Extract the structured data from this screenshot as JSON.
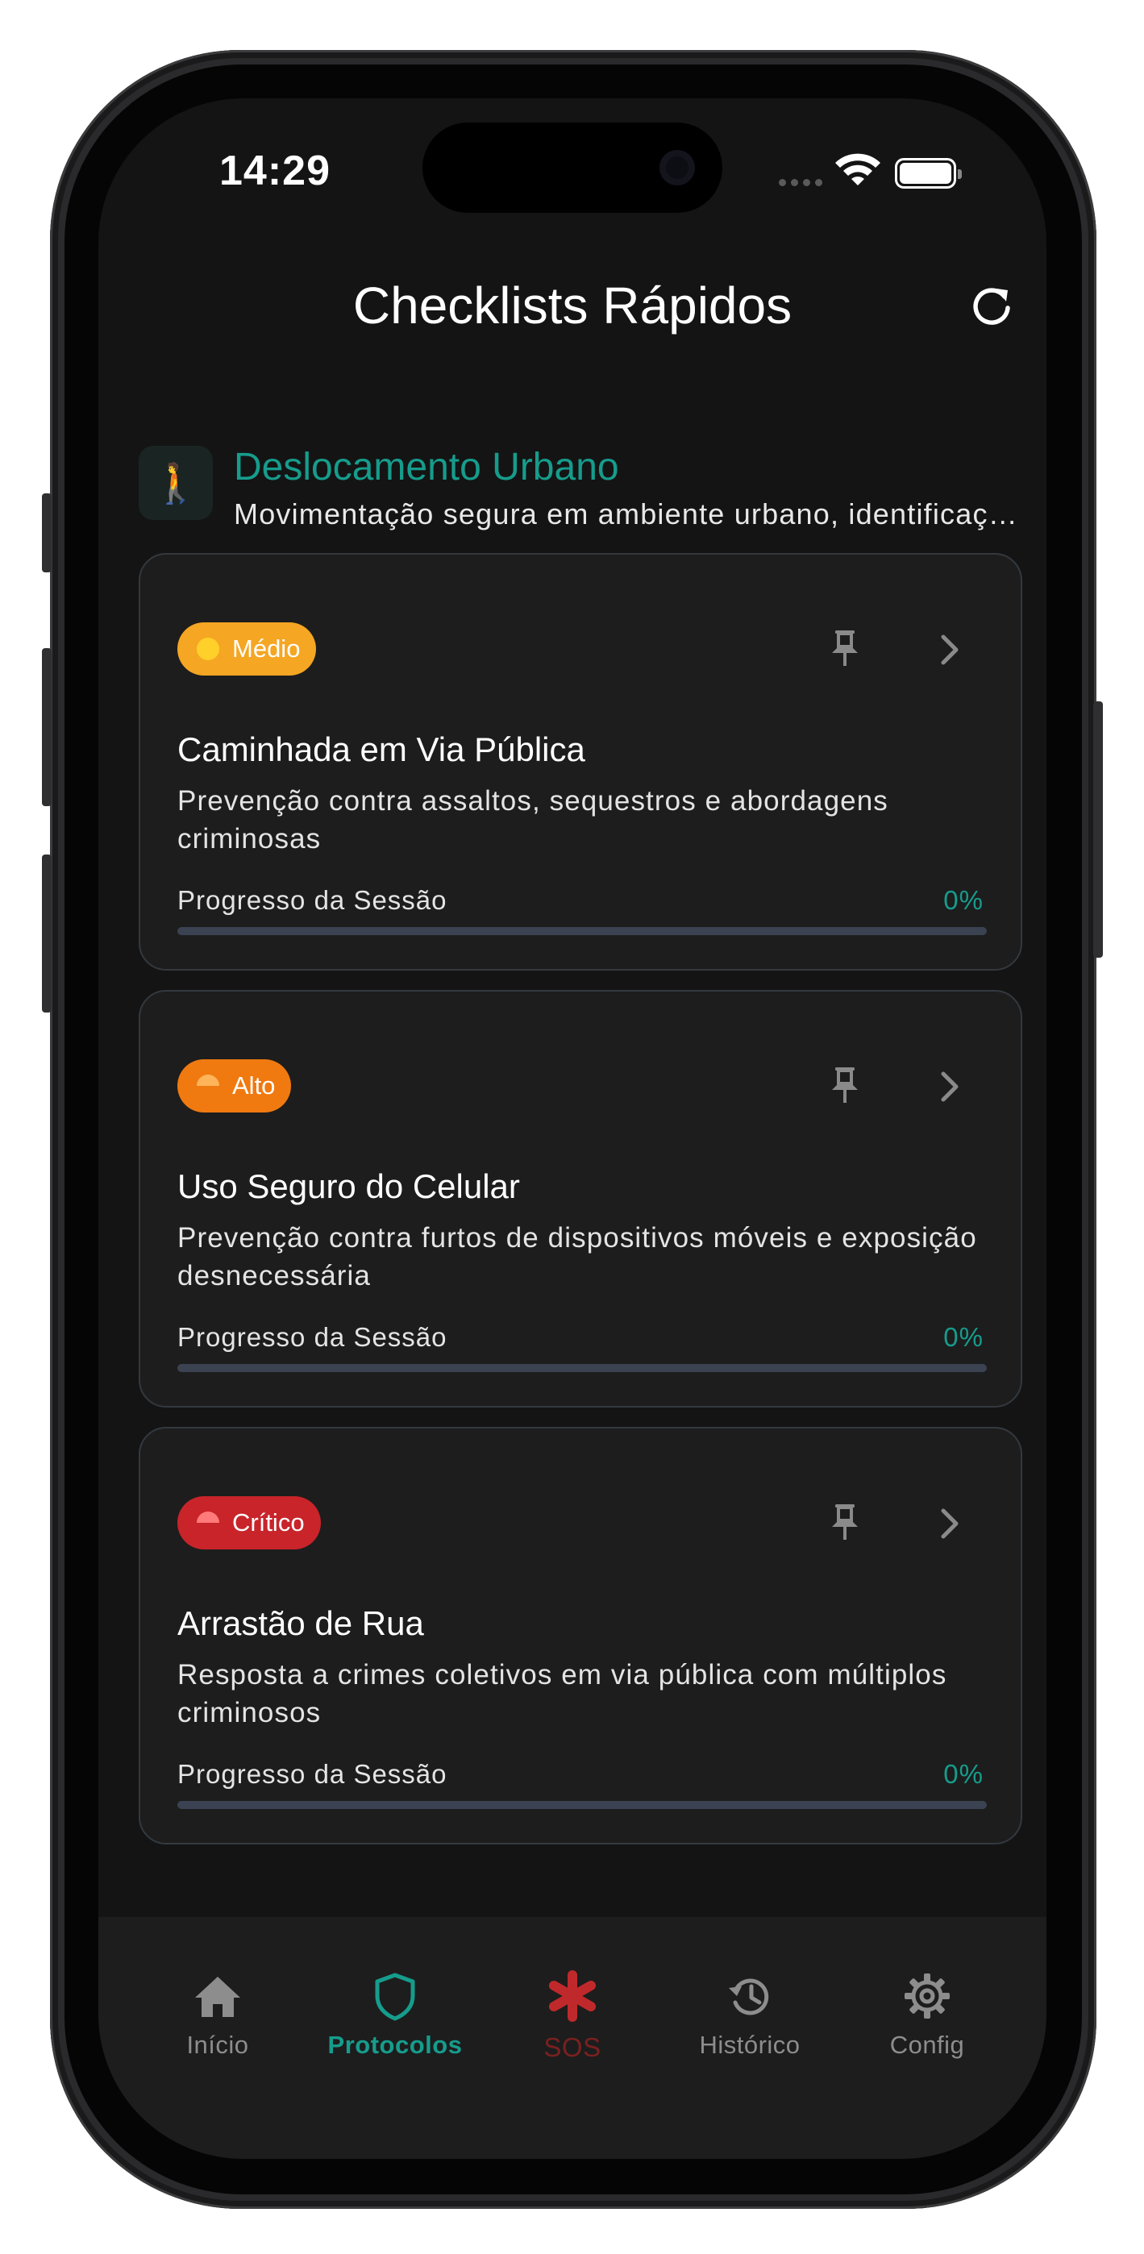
{
  "status_bar": {
    "time": "14:29"
  },
  "header": {
    "title": "Checklists Rápidos",
    "refresh_icon": "refresh-icon"
  },
  "category": {
    "icon": "🚶",
    "title": "Deslocamento Urbano",
    "description": "Movimentação segura em ambiente urbano, identificação de riscos"
  },
  "cards": [
    {
      "badge": "Médio",
      "badge_color": "#f5a623",
      "dot_color": "#ffd02a",
      "title": "Caminhada em Via Pública",
      "description": "Prevenção contra assaltos, sequestros e abordagens criminosas",
      "progress_label": "Progresso da Sessão",
      "progress_text": "0%",
      "progress": 0
    },
    {
      "badge": "Alto",
      "badge_color": "#f07a10",
      "dot_color": "#ffae4a",
      "title": "Uso Seguro do Celular",
      "description": "Prevenção contra furtos de dispositivos móveis e exposição desnecessária",
      "progress_label": "Progresso da Sessão",
      "progress_text": "0%",
      "progress": 0
    },
    {
      "badge": "Crítico",
      "badge_color": "#c8242a",
      "dot_color": "#ff6b6b",
      "title": "Arrastão de Rua",
      "description": "Resposta a crimes coletivos em via pública com múltiplos criminosos",
      "progress_label": "Progresso da Sessão",
      "progress_text": "0%",
      "progress": 0
    }
  ],
  "nav": {
    "items": [
      {
        "label": "Início",
        "icon": "home-icon"
      },
      {
        "label": "Protocolos",
        "icon": "shield-icon"
      },
      {
        "label": "SOS",
        "icon": "asterisk-icon"
      },
      {
        "label": "Histórico",
        "icon": "history-icon"
      },
      {
        "label": "Config",
        "icon": "gear-icon"
      }
    ],
    "active": "Protocolos"
  },
  "colors": {
    "accent": "#169c8c",
    "background": "#141414",
    "card": "#1d1d1d",
    "sos": "#c0292b"
  }
}
